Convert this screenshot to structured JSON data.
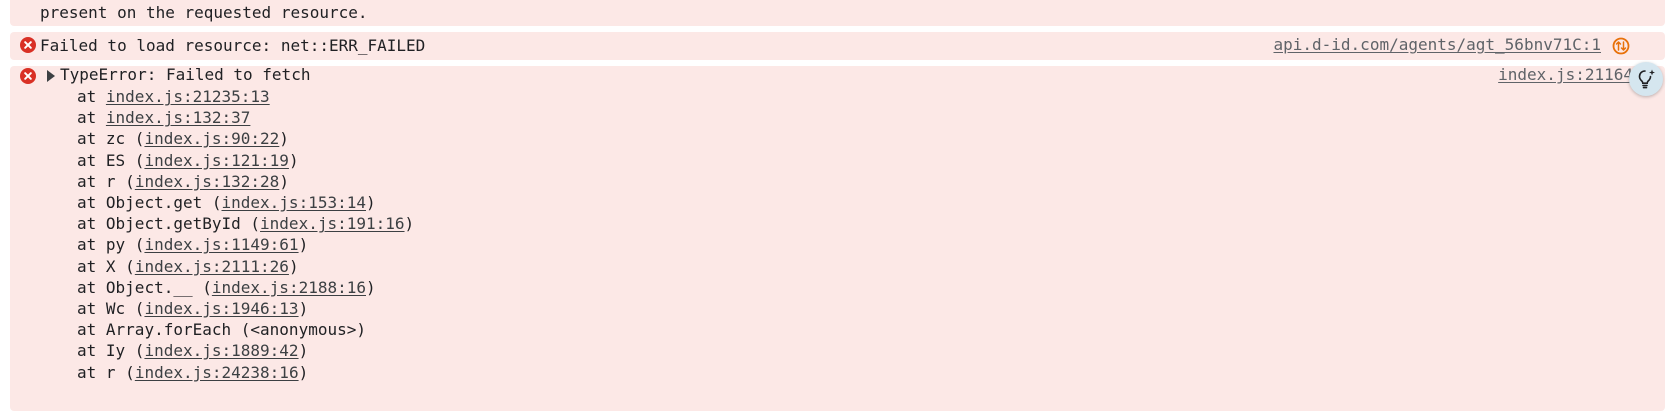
{
  "messages": {
    "m0": {
      "text": "present on the requested resource."
    },
    "m1": {
      "text": "Failed to load resource: net::ERR_FAILED",
      "source": "api.d-id.com/agents/agt_56bnv71C:1"
    },
    "m2": {
      "header": "TypeError: Failed to fetch",
      "source": "index.js:21164",
      "stack": [
        {
          "pre": "at ",
          "fn": "",
          "link": "index.js:21235:13",
          "post": ""
        },
        {
          "pre": "at ",
          "fn": "",
          "link": "index.js:132:37",
          "post": ""
        },
        {
          "pre": "at ",
          "fn": "zc (",
          "link": "index.js:90:22",
          "post": ")"
        },
        {
          "pre": "at ",
          "fn": "ES (",
          "link": "index.js:121:19",
          "post": ")"
        },
        {
          "pre": "at ",
          "fn": "r (",
          "link": "index.js:132:28",
          "post": ")"
        },
        {
          "pre": "at ",
          "fn": "Object.get (",
          "link": "index.js:153:14",
          "post": ")"
        },
        {
          "pre": "at ",
          "fn": "Object.getById (",
          "link": "index.js:191:16",
          "post": ")"
        },
        {
          "pre": "at ",
          "fn": "py (",
          "link": "index.js:1149:61",
          "post": ")"
        },
        {
          "pre": "at ",
          "fn": "X (",
          "link": "index.js:2111:26",
          "post": ")"
        },
        {
          "pre": "at ",
          "fn": "Object.__ (",
          "link": "index.js:2188:16",
          "post": ")"
        },
        {
          "pre": "at ",
          "fn": "Wc (",
          "link": "index.js:1946:13",
          "post": ")"
        },
        {
          "pre": "at ",
          "fn": "Array.forEach (<anonymous>)",
          "link": "",
          "post": ""
        },
        {
          "pre": "at ",
          "fn": "Iy (",
          "link": "index.js:1889:42",
          "post": ")"
        },
        {
          "pre": "at ",
          "fn": "r (",
          "link": "index.js:24238:16",
          "post": ")"
        }
      ]
    }
  },
  "icons": {
    "error": "error-circle-icon",
    "network": "network-request-icon",
    "insight": "lightbulb-insight-icon",
    "expand": "expand-triangle-icon"
  },
  "colors": {
    "row_bg": "#fce8e6",
    "error_icon": "#d93025",
    "network_icon": "#e8710a",
    "bulb_bg": "#d5e6ef"
  }
}
